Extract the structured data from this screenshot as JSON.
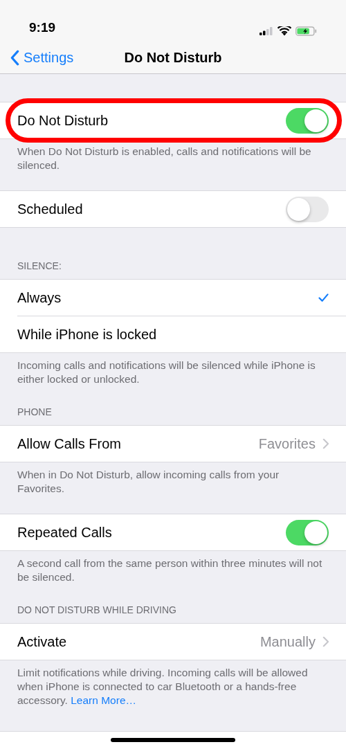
{
  "status_bar": {
    "time": "9:19"
  },
  "nav": {
    "back": "Settings",
    "title": "Do Not Disturb"
  },
  "sections": [
    {
      "rows": [
        {
          "kind": "toggle",
          "label": "Do Not Disturb",
          "on": true,
          "highlighted": true
        }
      ],
      "footer": {
        "text": "When Do Not Disturb is enabled, calls and notifications will be silenced."
      }
    },
    {
      "rows": [
        {
          "kind": "toggle",
          "label": "Scheduled",
          "on": false,
          "highlighted": false
        }
      ]
    },
    {
      "header": "SILENCE:",
      "rows": [
        {
          "kind": "check",
          "label": "Always",
          "selected": true,
          "highlighted": false
        },
        {
          "kind": "check",
          "label": "While iPhone is locked",
          "selected": false,
          "highlighted": false
        }
      ],
      "footer": {
        "text": "Incoming calls and notifications will be silenced while iPhone is either locked or unlocked."
      }
    },
    {
      "header": "PHONE",
      "rows": [
        {
          "kind": "detail",
          "label": "Allow Calls From",
          "value": "Favorites",
          "highlighted": false
        }
      ],
      "footer": {
        "text": "When in Do Not Disturb, allow incoming calls from your Favorites."
      }
    },
    {
      "rows": [
        {
          "kind": "toggle",
          "label": "Repeated Calls",
          "on": true,
          "highlighted": false
        }
      ],
      "footer": {
        "text": "A second call from the same person within three minutes will not be silenced."
      }
    },
    {
      "header": "DO NOT DISTURB WHILE DRIVING",
      "rows": [
        {
          "kind": "detail",
          "label": "Activate",
          "value": "Manually",
          "highlighted": false
        }
      ],
      "footer": {
        "text": "Limit notifications while driving. Incoming calls will be allowed when iPhone is connected to car Bluetooth or a hands-free accessory.",
        "link": "Learn More…"
      }
    }
  ]
}
